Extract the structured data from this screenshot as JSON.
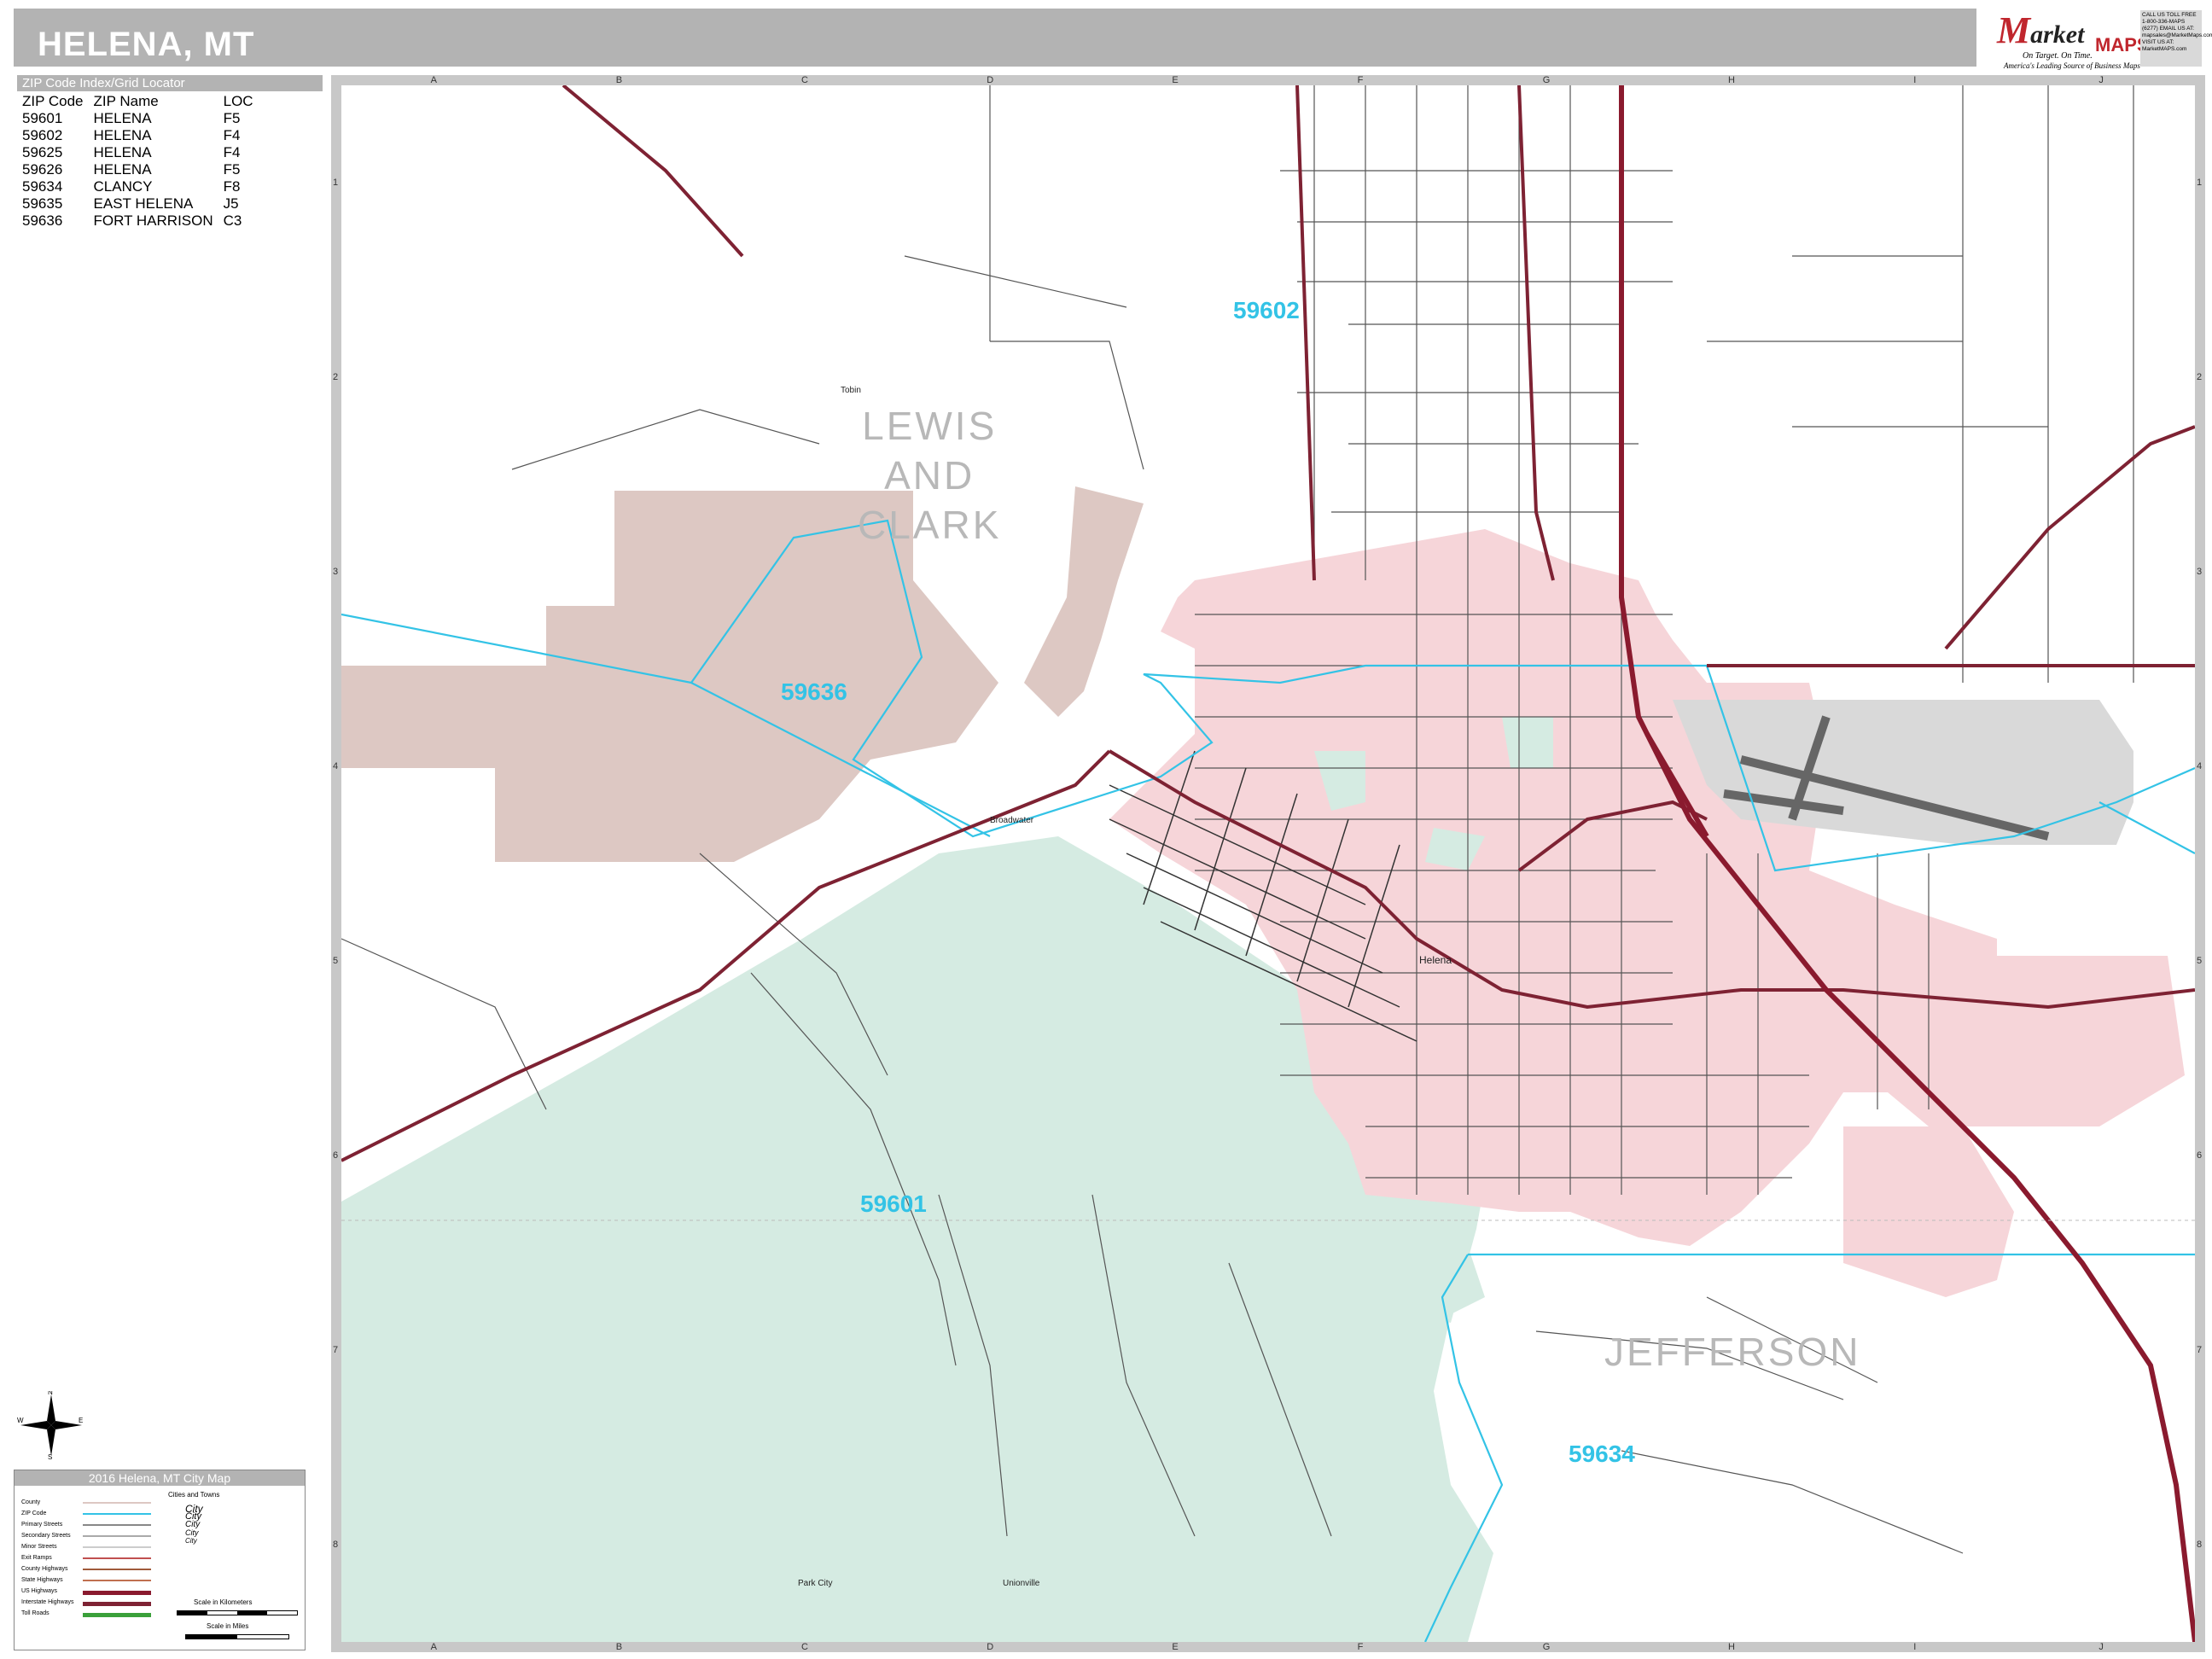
{
  "header": {
    "title": "HELENA, MT"
  },
  "logo": {
    "brand_first": "M",
    "brand_rest": "arket",
    "brand_second": "MAPS",
    "tagline": "On Target.  On Time.",
    "subtag": "America's Leading Source of Business Maps",
    "contact": "CALL US TOLL FREE 1-800-336-MAPS (6277)  EMAIL US AT: mapsales@MarketMaps.com  VISIT US AT: MarketMAPS.com"
  },
  "zip_index": {
    "heading": "ZIP Code Index/Grid Locator",
    "columns": [
      "ZIP Code",
      "ZIP Name",
      "LOC"
    ],
    "rows": [
      [
        "59601",
        "HELENA",
        "F5"
      ],
      [
        "59602",
        "HELENA",
        "F4"
      ],
      [
        "59625",
        "HELENA",
        "F4"
      ],
      [
        "59626",
        "HELENA",
        "F5"
      ],
      [
        "59634",
        "CLANCY",
        "F8"
      ],
      [
        "59635",
        "EAST HELENA",
        "J5"
      ],
      [
        "59636",
        "FORT HARRISON",
        "C3"
      ]
    ]
  },
  "grid": {
    "columns": [
      "A",
      "B",
      "C",
      "D",
      "E",
      "F",
      "G",
      "H",
      "I",
      "J"
    ],
    "rows": [
      "1",
      "2",
      "3",
      "4",
      "5",
      "6",
      "7",
      "8"
    ]
  },
  "map": {
    "counties": [
      "LEWIS\nAND\nCLARK",
      "JEFFERSON"
    ],
    "zip_labels": [
      "59602",
      "59636",
      "59601",
      "59634"
    ],
    "places": [
      "Helena",
      "Broadwater",
      "Tobin",
      "Park City",
      "Unionville"
    ],
    "colors": {
      "city": "#f6d5d9",
      "forest": "#d5ebe2",
      "reservation": "#ddc8c3",
      "airport": "#d9d9d9",
      "zip_boundary": "#33c3e6",
      "interstate": "#8a1a2e",
      "us_highway": "#7e2233",
      "streets": "#555555"
    }
  },
  "compass": {
    "n": "N",
    "s": "S",
    "e": "E",
    "w": "W"
  },
  "legend": {
    "title": "2016 Helena, MT City Map",
    "items": [
      "County",
      "ZIP Code",
      "Primary Streets",
      "Secondary Streets",
      "Minor Streets",
      "Exit Ramps",
      "County Highways",
      "State Highways",
      "US Highways",
      "Interstate Highways",
      "Toll Roads"
    ],
    "cities_heading": "Cities and Towns",
    "city_samples": [
      "City",
      "City",
      "City",
      "City",
      "City"
    ],
    "scale_km": "Scale in Kilometers",
    "scale_mi": "Scale in Miles"
  }
}
